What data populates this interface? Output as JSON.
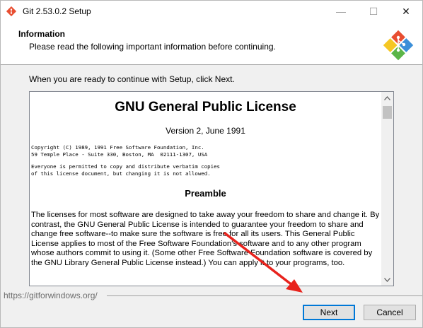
{
  "window": {
    "title": "Git 2.53.0.2 Setup",
    "controls": {
      "minimize": "—",
      "maximize": "☐",
      "close": "✕"
    }
  },
  "header": {
    "title": "Information",
    "subtitle": "Please read the following important information before continuing."
  },
  "body": {
    "intro": "When you are ready to continue with Setup, click Next."
  },
  "license": {
    "title": "GNU General Public License",
    "version": "Version 2, June 1991",
    "copyright": "Copyright (C) 1989, 1991 Free Software Foundation, Inc.\n59 Temple Place - Suite 330, Boston, MA  02111-1307, USA",
    "permission": "Everyone is permitted to copy and distribute verbatim copies\nof this license document, but changing it is not allowed.",
    "preamble_heading": "Preamble",
    "preamble_text": "The licenses for most software are designed to take away your freedom to share and change it. By contrast, the GNU General Public License is intended to guarantee your freedom to share and change free software--to make sure the software is free for all its users. This General Public License applies to most of the Free Software Foundation's software and to any other program whose authors commit to using it. (Some other Free Software Foundation software is covered by the GNU Library General Public License instead.) You can apply it to your programs, too."
  },
  "footer": {
    "link": "https://gitforwindows.org/",
    "next_label": "Next",
    "cancel_label": "Cancel"
  },
  "colors": {
    "annotation_arrow": "#e8231d",
    "focus_border": "#0078d7",
    "logo_red": "#e84e31",
    "logo_blue": "#3b8fd9",
    "logo_yellow": "#f5c724",
    "logo_green": "#5bb548"
  },
  "icons": [
    "git-logo-icon",
    "minimize-icon",
    "maximize-icon",
    "close-icon",
    "scroll-up-icon",
    "scroll-down-icon",
    "annotation-arrow"
  ]
}
